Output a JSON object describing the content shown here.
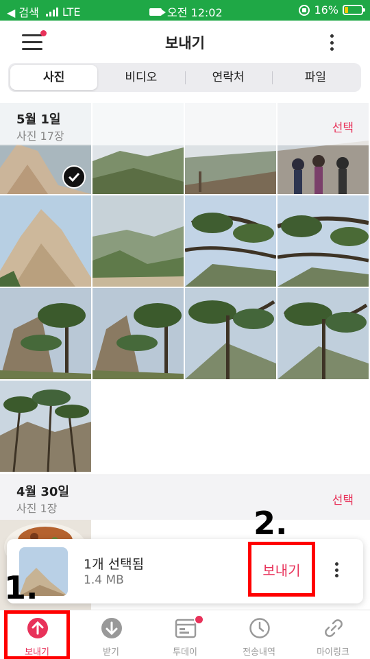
{
  "status_bar": {
    "back_label": "◀ 검색",
    "network": "LTE",
    "time": "오전 12:02",
    "battery": "16%",
    "battery_level": 0.16,
    "bg_color": "#1fa846"
  },
  "header": {
    "title": "보내기",
    "menu_icon": "hamburger-menu-icon",
    "more_icon": "more-vertical-icon"
  },
  "tabs": [
    {
      "label": "사진",
      "active": true
    },
    {
      "label": "비디오",
      "active": false
    },
    {
      "label": "연락처",
      "active": false
    },
    {
      "label": "파일",
      "active": false
    }
  ],
  "sections": [
    {
      "date": "5월 1일",
      "count": "사진 17장",
      "select_label": "선택"
    },
    {
      "date": "4월 30일",
      "count": "사진 1장",
      "select_label": "선택"
    }
  ],
  "selection": {
    "count_label": "1개 선택됨",
    "size_label": "1.4 MB",
    "send_label": "보내기"
  },
  "bottom_nav": [
    {
      "label": "보내기",
      "icon": "upload-circle-icon",
      "active": true
    },
    {
      "label": "받기",
      "icon": "download-circle-icon",
      "active": false
    },
    {
      "label": "투데이",
      "icon": "today-calendar-icon",
      "active": false
    },
    {
      "label": "전송내역",
      "icon": "clock-icon",
      "active": false
    },
    {
      "label": "마이링크",
      "icon": "link-icon",
      "active": false
    }
  ],
  "annotations": {
    "step1": "1.",
    "step2": "2."
  },
  "colors": {
    "accent": "#e8325a",
    "highlight": "#ff0000"
  }
}
